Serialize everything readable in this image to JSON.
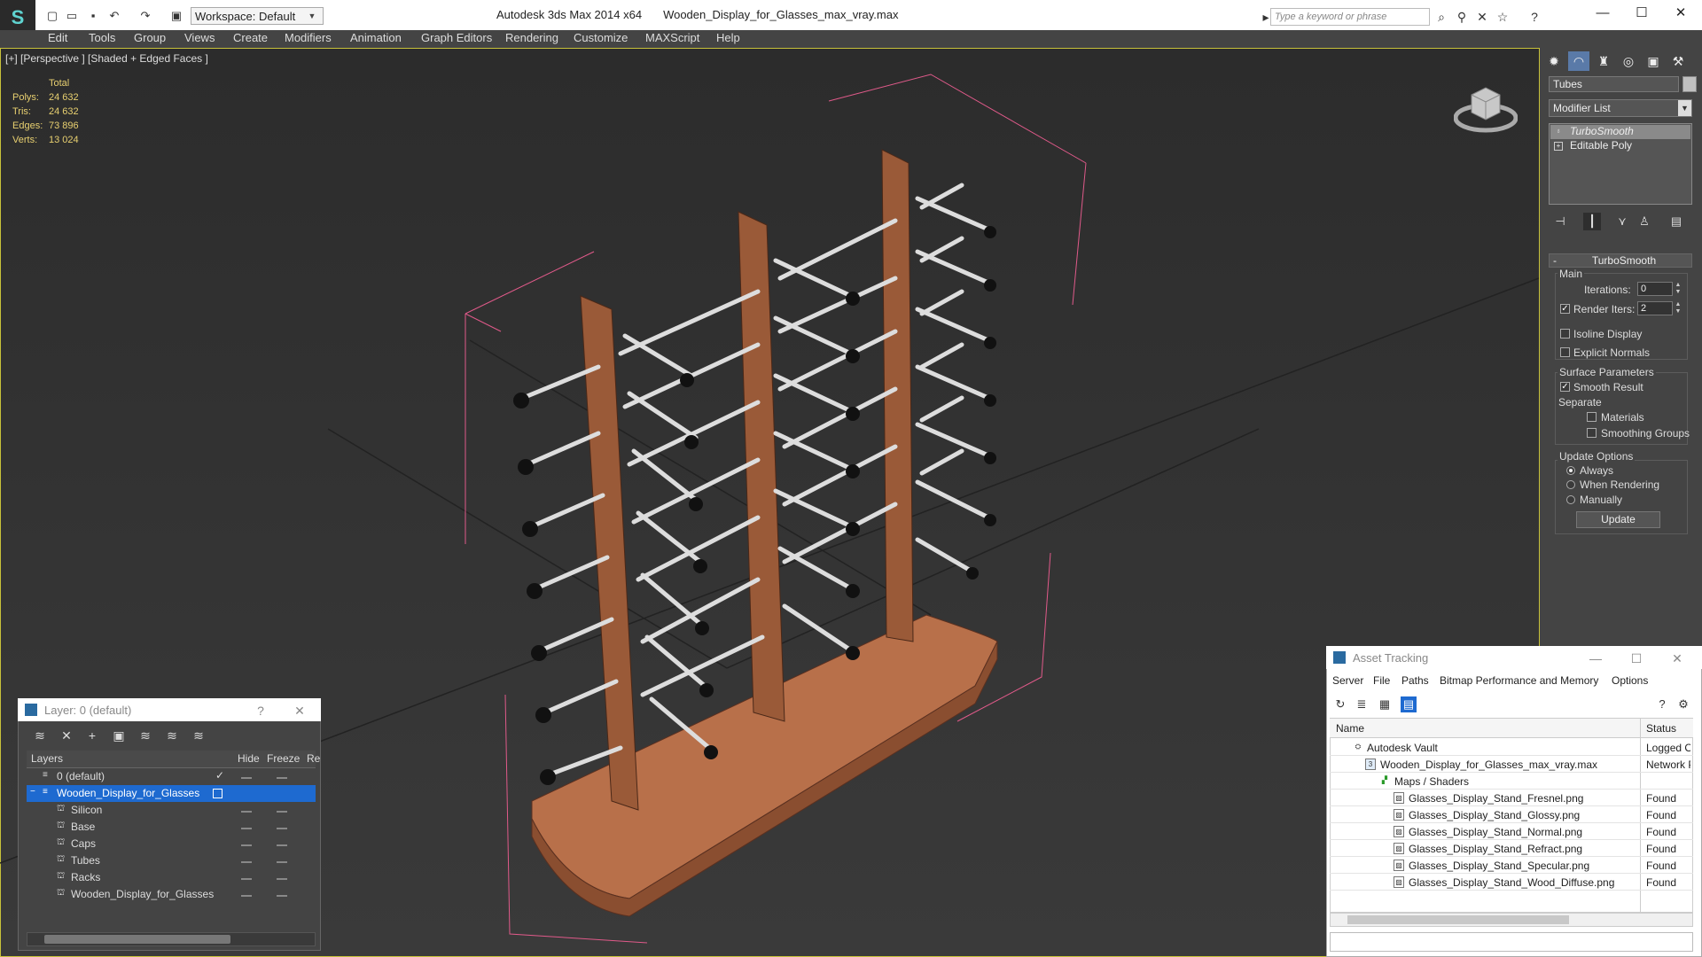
{
  "titlebar": {
    "workspace": "Workspace: Default",
    "app_title": "Autodesk 3ds Max  2014 x64",
    "file_title": "Wooden_Display_for_Glasses_max_vray.max",
    "search_placeholder": "Type a keyword or phrase"
  },
  "menu": [
    "Edit",
    "Tools",
    "Group",
    "Views",
    "Create",
    "Modifiers",
    "Animation",
    "Graph Editors",
    "Rendering",
    "Customize",
    "MAXScript",
    "Help"
  ],
  "viewport": {
    "label": "[+] [Perspective ] [Shaded + Edged Faces ]",
    "stats_header": "Total",
    "stats": [
      {
        "label": "Polys:",
        "value": "24 632"
      },
      {
        "label": "Tris:",
        "value": "24 632"
      },
      {
        "label": "Edges:",
        "value": "73 896"
      },
      {
        "label": "Verts:",
        "value": "13 024"
      }
    ]
  },
  "command_panel": {
    "object_name": "Tubes",
    "modifier_list": "Modifier List",
    "stack": [
      "TurboSmooth",
      "Editable Poly"
    ],
    "rollout_title": "TurboSmooth",
    "main_label": "Main",
    "iterations_label": "Iterations:",
    "iterations_value": "0",
    "render_iters_label": "Render Iters:",
    "render_iters_value": "2",
    "isoline": "Isoline Display",
    "explicit_normals": "Explicit Normals",
    "surface_params": "Surface Parameters",
    "smooth_result": "Smooth Result",
    "separate": "Separate",
    "materials": "Materials",
    "smoothing_groups": "Smoothing Groups",
    "update_options": "Update Options",
    "always": "Always",
    "when_rendering": "When Rendering",
    "manually": "Manually",
    "update_button": "Update"
  },
  "layer_dialog": {
    "title": "Layer: 0 (default)",
    "help": "?",
    "columns": [
      "Layers",
      "Hide",
      "Freeze",
      "Re"
    ],
    "rows": [
      {
        "name": "0 (default)",
        "indent": 0
      },
      {
        "name": "Wooden_Display_for_Glasses",
        "indent": 0,
        "selected": true
      },
      {
        "name": "Silicon",
        "indent": 1
      },
      {
        "name": "Base",
        "indent": 1
      },
      {
        "name": "Caps",
        "indent": 1
      },
      {
        "name": "Tubes",
        "indent": 1
      },
      {
        "name": "Racks",
        "indent": 1
      },
      {
        "name": "Wooden_Display_for_Glasses",
        "indent": 1
      }
    ]
  },
  "asset_tracking": {
    "title": "Asset Tracking",
    "menu": [
      "Server",
      "File",
      "Paths",
      "Bitmap Performance and Memory",
      "Options"
    ],
    "columns": [
      "Name",
      "Status"
    ],
    "rows": [
      {
        "name": "Autodesk Vault",
        "status": "Logged Ou",
        "indent": 1
      },
      {
        "name": "Wooden_Display_for_Glasses_max_vray.max",
        "status": "Network P",
        "indent": 2
      },
      {
        "name": "Maps / Shaders",
        "status": "",
        "indent": 3
      },
      {
        "name": "Glasses_Display_Stand_Fresnel.png",
        "status": "Found",
        "indent": 4
      },
      {
        "name": "Glasses_Display_Stand_Glossy.png",
        "status": "Found",
        "indent": 4
      },
      {
        "name": "Glasses_Display_Stand_Normal.png",
        "status": "Found",
        "indent": 4
      },
      {
        "name": "Glasses_Display_Stand_Refract.png",
        "status": "Found",
        "indent": 4
      },
      {
        "name": "Glasses_Display_Stand_Specular.png",
        "status": "Found",
        "indent": 4
      },
      {
        "name": "Glasses_Display_Stand_Wood_Diffuse.png",
        "status": "Found",
        "indent": 4
      }
    ]
  },
  "colors": {
    "viewport_border": "#c8c23a",
    "stats": "#e8d070",
    "selection": "#1e6ad0",
    "wood": "#b8704a",
    "bbox": "#e05a8a"
  }
}
